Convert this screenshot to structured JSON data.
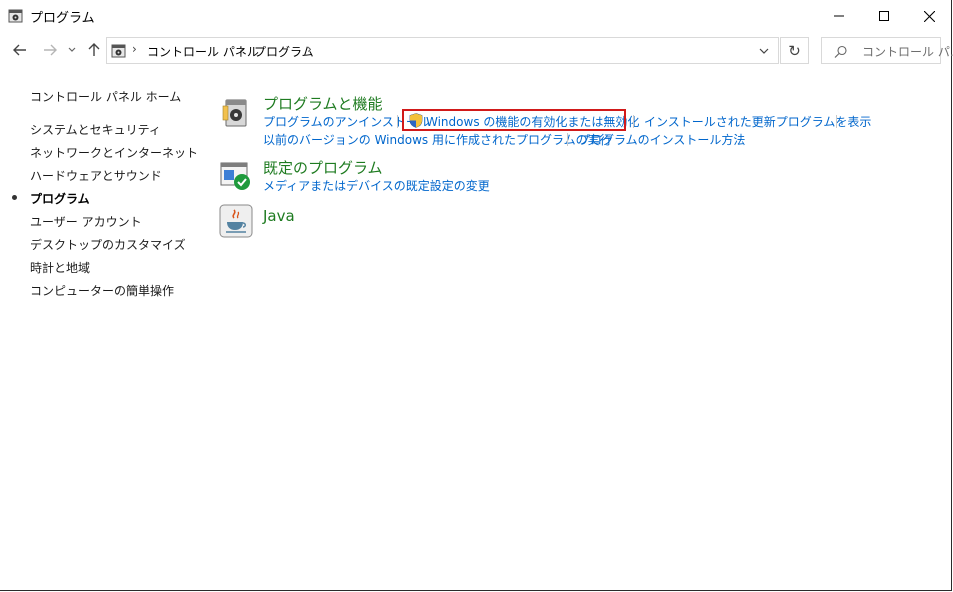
{
  "window": {
    "title": "プログラム"
  },
  "address": {
    "crumbs": [
      "コントロール パネル",
      "プログラム"
    ],
    "separator": "›"
  },
  "search": {
    "placeholder": "コントロール パ..."
  },
  "sidebar": {
    "home": "コントロール パネル ホーム",
    "items": [
      {
        "label": "システムとセキュリティ"
      },
      {
        "label": "ネットワークとインターネット"
      },
      {
        "label": "ハードウェアとサウンド"
      },
      {
        "label": "プログラム",
        "active": true
      },
      {
        "label": "ユーザー アカウント"
      },
      {
        "label": "デスクトップのカスタマイズ"
      },
      {
        "label": "時計と地域"
      },
      {
        "label": "コンピューターの簡単操作"
      }
    ]
  },
  "categories": [
    {
      "title": "プログラムと機能",
      "icon": "programs-features-icon",
      "links_row1": [
        "プログラムのアンインストール",
        "Windows の機能の有効化または無効化",
        "インストールされた更新プログラムを表示"
      ],
      "links_row2": [
        "以前のバージョンの Windows 用に作成されたプログラムの実行",
        "プログラムのインストール方法"
      ]
    },
    {
      "title": "既定のプログラム",
      "icon": "default-programs-icon",
      "links_row1": [
        "メディアまたはデバイスの既定設定の変更"
      ]
    },
    {
      "title": "Java",
      "icon": "java-icon"
    }
  ],
  "colors": {
    "category_title": "#1e7b20",
    "link": "#0066cc",
    "highlight": "#d11a1a"
  }
}
